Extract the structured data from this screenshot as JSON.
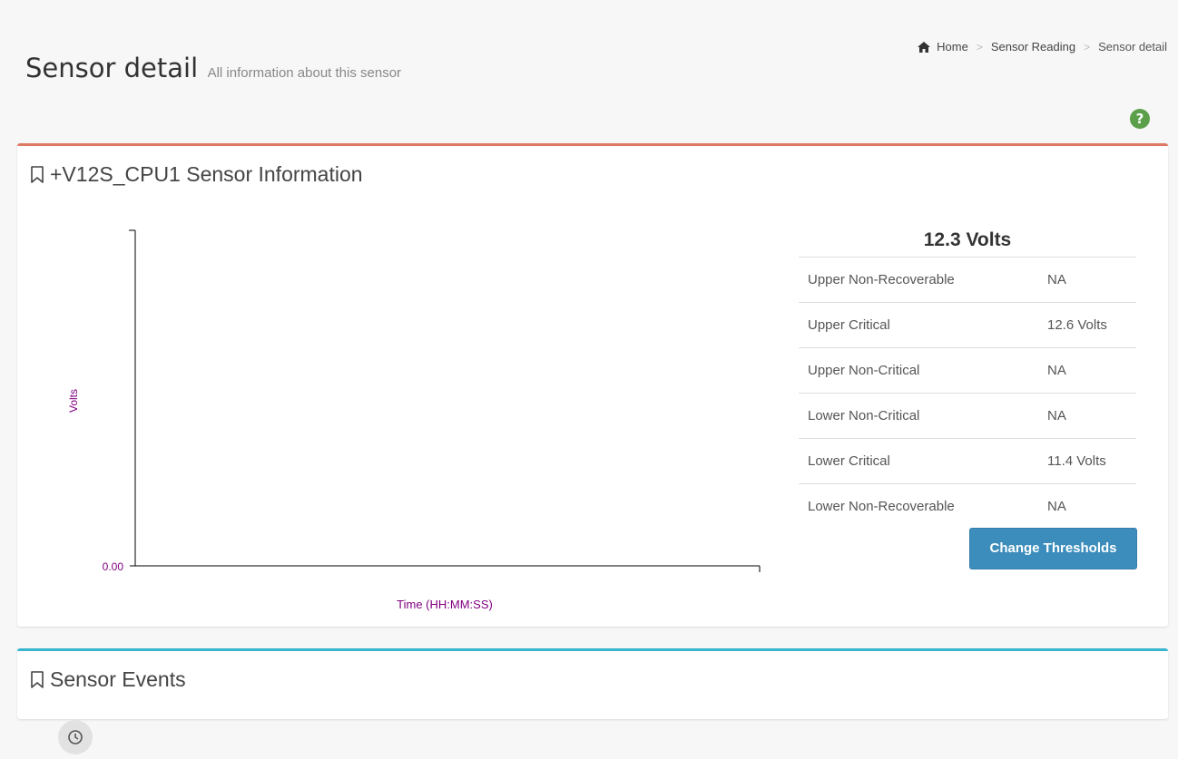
{
  "header": {
    "title": "Sensor detail",
    "subtitle": "All information about this sensor"
  },
  "breadcrumb": {
    "items": [
      "Home",
      "Sensor Reading",
      "Sensor detail"
    ],
    "separator": ">"
  },
  "icons": {
    "help": "question-circle-icon",
    "home": "home-icon",
    "bookmark": "bookmark-icon",
    "history": "clock-icon"
  },
  "colors": {
    "sensor_box_accent": "#dd7a63",
    "events_box_accent": "#3ab5d1",
    "button": "#3c8dbc",
    "axis_text": "#800080",
    "help": "#5b9f4a"
  },
  "sensor_box": {
    "title": "+V12S_CPU1 Sensor Information",
    "reading": "12.3 Volts",
    "thresholds": [
      {
        "label": "Upper Non-Recoverable",
        "value": "NA"
      },
      {
        "label": "Upper Critical",
        "value": "12.6 Volts"
      },
      {
        "label": "Upper Non-Critical",
        "value": "NA"
      },
      {
        "label": "Lower Non-Critical",
        "value": "NA"
      },
      {
        "label": "Lower Critical",
        "value": "11.4 Volts"
      },
      {
        "label": "Lower Non-Recoverable",
        "value": "NA"
      }
    ],
    "change_button": "Change Thresholds"
  },
  "events_box": {
    "title": "Sensor Events"
  },
  "chart_data": {
    "type": "line",
    "xlabel": "Time (HH:MM:SS)",
    "ylabel": "Volts",
    "y_tick_labels": [
      "0.00"
    ],
    "series": [],
    "grid": false
  }
}
